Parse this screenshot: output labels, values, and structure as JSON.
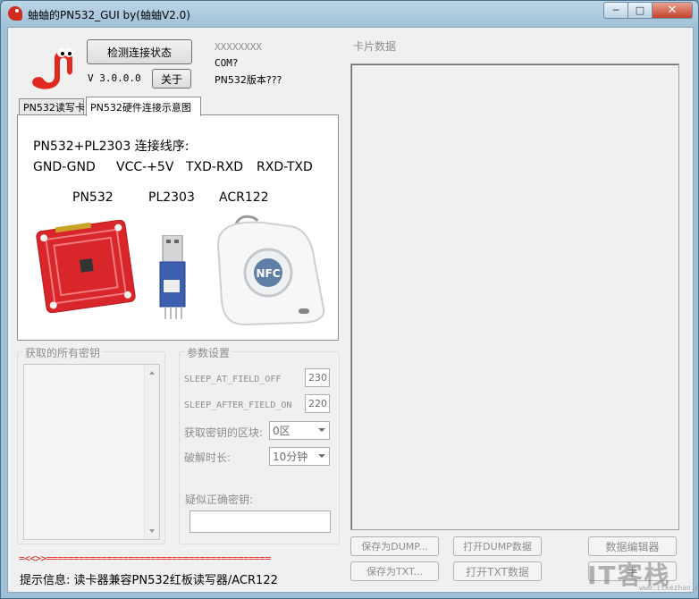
{
  "window": {
    "title": "蚰蚰的PN532_GUI by(蚰蚰V2.0)",
    "min_label": "─",
    "max_label": "□",
    "close_label": "✕"
  },
  "header": {
    "check_button": "检测连接状态",
    "version": "V 3.0.0.0",
    "about_button": "关于",
    "device_id": "XXXXXXXX",
    "port": "COM?",
    "pn532_version": "PN532版本???"
  },
  "tabs": [
    {
      "label": "PN532读写卡",
      "active": false
    },
    {
      "label": "PN532硬件连接示意图",
      "active": true
    }
  ],
  "diagram": {
    "heading": "PN532+PL2303  连接线序:",
    "wiring": [
      "GND-GND",
      "VCC-+5V",
      "TXD-RXD",
      "RXD-TXD"
    ],
    "devices": [
      "PN532",
      "PL2303",
      "ACR122"
    ],
    "nfc_logo": "NFC"
  },
  "keys_group": {
    "title": "获取的所有密钥"
  },
  "params": {
    "title": "参数设置",
    "sleep_field_off_label": "SLEEP_AT_FIELD_OFF",
    "sleep_field_off_value": "230",
    "sleep_field_on_label": "SLEEP_AFTER_FIELD_ON",
    "sleep_field_on_value": "220",
    "block_label": "获取密钥的区块:",
    "block_value": "0区",
    "time_label": "破解时长:",
    "time_value": "10分钟",
    "suspected_key_label": "疑似正确密钥:",
    "suspected_key_value": ""
  },
  "card_data": {
    "title": "卡片数据"
  },
  "buttons": {
    "save_dump": "保存为DUMP...",
    "open_dump": "打开DUMP数据",
    "data_editor": "数据编辑器",
    "save_txt": "保存为TXT...",
    "open_txt": "打开TXT数据",
    "extra": "手"
  },
  "status": {
    "separator": "=<<>>=========================================",
    "message": "提示信息: 读卡器兼容PN532红板读写器/ACR122"
  },
  "watermark": {
    "main": "IT客栈",
    "sub": "www.itkezhan.org"
  },
  "colors": {
    "separator": "#e0201a",
    "disabled_text": "#8d8d8d",
    "board_red": "#d9262b"
  }
}
